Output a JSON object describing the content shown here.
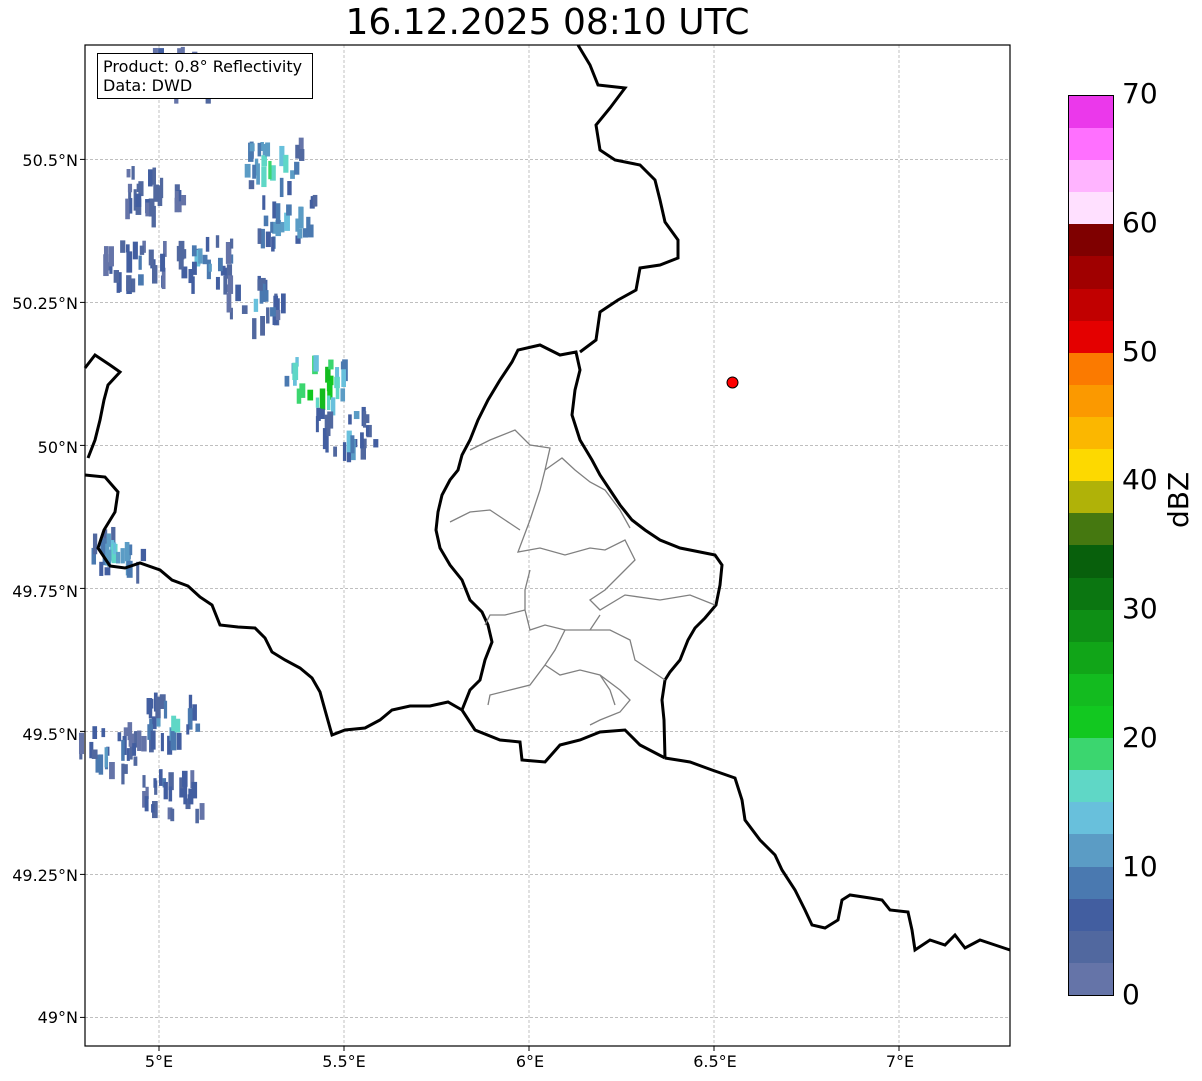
{
  "title": "16.12.2025 08:10 UTC",
  "info": {
    "product": "Product: 0.8° Reflectivity",
    "data_source": "Data: DWD"
  },
  "map": {
    "lon_range": [
      4.8,
      7.3
    ],
    "lat_range": [
      48.95,
      50.7
    ],
    "lat_ticks": [
      {
        "value": 50.5,
        "label": "50.5°N"
      },
      {
        "value": 50.25,
        "label": "50.25°N"
      },
      {
        "value": 50.0,
        "label": "50°N"
      },
      {
        "value": 49.75,
        "label": "49.75°N"
      },
      {
        "value": 49.5,
        "label": "49.5°N"
      },
      {
        "value": 49.25,
        "label": "49.25°N"
      },
      {
        "value": 49.0,
        "label": "49°N"
      }
    ],
    "lon_ticks": [
      {
        "value": 5.0,
        "label": "5°E"
      },
      {
        "value": 5.5,
        "label": "5.5°E"
      },
      {
        "value": 6.0,
        "label": "6°E"
      },
      {
        "value": 6.5,
        "label": "6.5°E"
      },
      {
        "value": 7.0,
        "label": "7°E"
      }
    ],
    "radar_site": {
      "lon": 6.55,
      "lat": 50.11,
      "color": "#ff0000"
    },
    "echo_cells": [
      {
        "lon": 5.05,
        "lat": 50.66,
        "dbz": 6
      },
      {
        "lon": 4.98,
        "lat": 50.45,
        "dbz": 6
      },
      {
        "lon": 5.12,
        "lat": 50.33,
        "dbz": 12
      },
      {
        "lon": 4.93,
        "lat": 50.32,
        "dbz": 8
      },
      {
        "lon": 5.3,
        "lat": 50.5,
        "dbz": 18
      },
      {
        "lon": 5.34,
        "lat": 50.4,
        "dbz": 14
      },
      {
        "lon": 5.25,
        "lat": 50.26,
        "dbz": 10
      },
      {
        "lon": 5.42,
        "lat": 50.12,
        "dbz": 30
      },
      {
        "lon": 5.5,
        "lat": 50.03,
        "dbz": 12
      },
      {
        "lon": 4.88,
        "lat": 49.82,
        "dbz": 14
      },
      {
        "lon": 5.03,
        "lat": 49.53,
        "dbz": 14
      },
      {
        "lon": 4.86,
        "lat": 49.48,
        "dbz": 8
      },
      {
        "lon": 5.03,
        "lat": 49.4,
        "dbz": 8
      }
    ]
  },
  "colorbar": {
    "label": "dBZ",
    "range": [
      0,
      70
    ],
    "tick_labels": [
      "0",
      "10",
      "20",
      "30",
      "40",
      "50",
      "60",
      "70"
    ],
    "colors": [
      "#6574a8",
      "#51689f",
      "#425ea0",
      "#4a79b0",
      "#5b9cc5",
      "#68c0dc",
      "#5fd7c6",
      "#3bd66f",
      "#12c820",
      "#13bb1f",
      "#11a518",
      "#0e8f15",
      "#0b7611",
      "#08600c",
      "#457810",
      "#b0b208",
      "#fdd900",
      "#fbb700",
      "#fb9900",
      "#fb7a00",
      "#e40000",
      "#c10000",
      "#a00000",
      "#7f0000",
      "#ffe0ff",
      "#ffb4ff",
      "#ff70ff",
      "#eb38eb"
    ]
  }
}
